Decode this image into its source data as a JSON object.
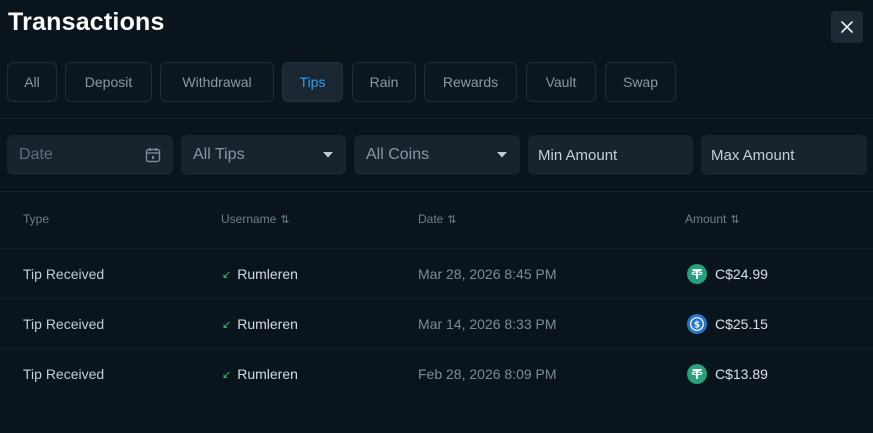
{
  "header": {
    "title": "Transactions"
  },
  "tabs": [
    {
      "label": "All"
    },
    {
      "label": "Deposit"
    },
    {
      "label": "Withdrawal"
    },
    {
      "label": "Tips"
    },
    {
      "label": "Rain"
    },
    {
      "label": "Rewards"
    },
    {
      "label": "Vault"
    },
    {
      "label": "Swap"
    }
  ],
  "active_tab": "Tips",
  "filters": {
    "date_placeholder": "Date",
    "tips_value": "All Tips",
    "coins_value": "All Coins",
    "min_placeholder": "Min Amount",
    "max_placeholder": "Max Amount"
  },
  "table": {
    "headers": {
      "type": "Type",
      "username": "Username",
      "date": "Date",
      "amount": "Amount"
    },
    "rows": [
      {
        "type": "Tip Received",
        "username": "Rumleren",
        "date": "Mar 28, 2026 8:45 PM",
        "amount": "C$24.99",
        "coin": "usdt-icon"
      },
      {
        "type": "Tip Received",
        "username": "Rumleren",
        "date": "Mar 14, 2026 8:33 PM",
        "amount": "C$25.15",
        "coin": "usdc-icon"
      },
      {
        "type": "Tip Received",
        "username": "Rumleren",
        "date": "Feb 28, 2026 8:09 PM",
        "amount": "C$13.89",
        "coin": "usdt-icon"
      }
    ]
  },
  "colors": {
    "background": "#0a141c",
    "accent": "#2f9ef2",
    "usdt": "#26a17b",
    "usdc": "#2775ca",
    "received_arrow": "#38c172"
  }
}
